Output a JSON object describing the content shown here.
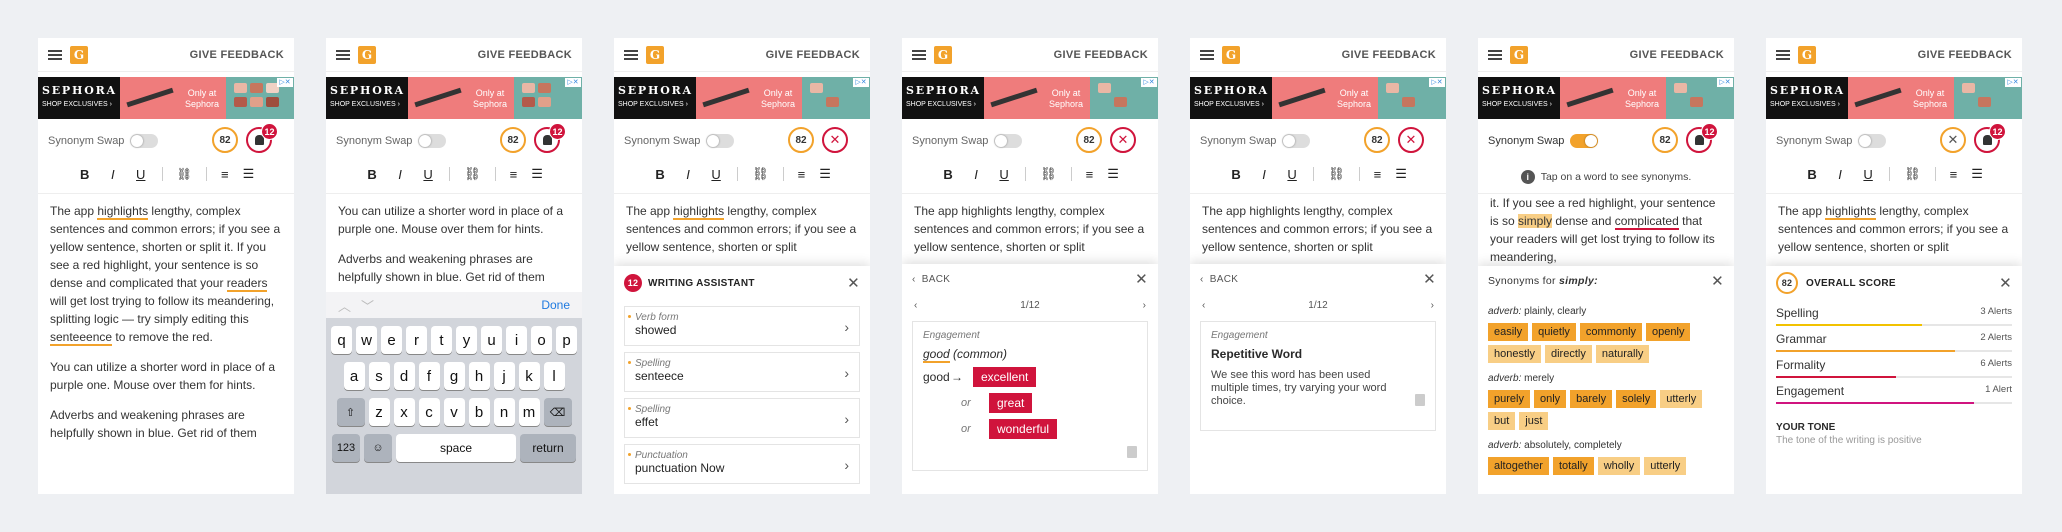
{
  "header": {
    "feedback_label": "GIVE FEEDBACK",
    "logo_letter": "G"
  },
  "ad": {
    "brand": "SEPHORA",
    "sub": "SHOP EXCLUSIVES ›",
    "only": "Only at Sephora",
    "adchoice": "▷✕"
  },
  "tools": {
    "synonym_swap": "Synonym Swap",
    "score": "82",
    "alerts": "12",
    "info": "Tap on a word to see synonyms."
  },
  "format": {
    "bold": "B",
    "italic": "I",
    "underline": "U",
    "link": "🔗",
    "ol": "☰",
    "ul": "☰"
  },
  "text": {
    "p1": [
      "The app ",
      "highlights",
      " lengthy, complex sentences and common errors; if you see a yellow sentence, shorten or split it. If you see a red highlight, your sentence is so dense and complicated that your ",
      "readers",
      " will get lost trying to follow its meandering, splitting logic — try simply editing this ",
      "senteeence",
      " to remove the red."
    ],
    "p2": "You can utilize a shorter word in place of a purple one. Mouse over them for hints.",
    "p3": "Adverbs and weakening phrases are helpfully shown in blue. Get rid of them",
    "p3_cut": "helpfully shown in blue. Get rid of them",
    "short": [
      "The app ",
      "highlights",
      " lengthy, complex sentences and common errors; if you see a yellow sentence, shorten or split"
    ],
    "syn_para": [
      "it. If you see a red highlight, your sentence is so ",
      "simply",
      " dense and ",
      "complicated",
      " that your readers will get lost trying to follow its meandering,"
    ]
  },
  "keyboard": {
    "done": "Done",
    "row1": [
      "q",
      "w",
      "e",
      "r",
      "t",
      "y",
      "u",
      "i",
      "o",
      "p"
    ],
    "row2": [
      "a",
      "s",
      "d",
      "f",
      "g",
      "h",
      "j",
      "k",
      "l"
    ],
    "row3": [
      "z",
      "x",
      "c",
      "v",
      "b",
      "n",
      "m"
    ],
    "num": "123",
    "emoji": "☺",
    "space": "space",
    "return": "return"
  },
  "assistant": {
    "title": "WRITING ASSISTANT",
    "alerts": [
      {
        "cat": "Verb form",
        "val": "showed"
      },
      {
        "cat": "Spelling",
        "val": "senteece"
      },
      {
        "cat": "Spelling",
        "val": "effet"
      },
      {
        "cat": "Punctuation",
        "val": "punctuation Now"
      }
    ]
  },
  "detail": {
    "back": "BACK",
    "pager": "1/12",
    "cat": "Engagement",
    "word": "good",
    "word_note": "(common)",
    "suggestions": [
      "excellent",
      "great",
      "wonderful"
    ],
    "or": "or",
    "card2_title": "Repetitive Word",
    "card2_desc": "We see this word has been used multiple times, try varying your word choice."
  },
  "synonyms": {
    "head": "Synonyms for ",
    "word": "simply:",
    "groups": [
      {
        "label": "adverb:",
        "meanings": "plainly, clearly",
        "words": [
          [
            "easily",
            "a"
          ],
          [
            "quietly",
            "a"
          ],
          [
            "commonly",
            "a"
          ],
          [
            "openly",
            "a"
          ],
          [
            "honestly",
            "b"
          ],
          [
            "directly",
            "b"
          ],
          [
            "naturally",
            "b"
          ]
        ]
      },
      {
        "label": "adverb:",
        "meanings": "merely",
        "words": [
          [
            "purely",
            "a"
          ],
          [
            "only",
            "a"
          ],
          [
            "barely",
            "a"
          ],
          [
            "solely",
            "a"
          ],
          [
            "utterly",
            "b"
          ],
          [
            "but",
            "b"
          ],
          [
            "just",
            "b"
          ]
        ]
      },
      {
        "label": "adverb:",
        "meanings": "absolutely, completely",
        "words": [
          [
            "altogether",
            "a"
          ],
          [
            "totally",
            "a"
          ],
          [
            "wholly",
            "b"
          ],
          [
            "utterly",
            "b"
          ]
        ]
      }
    ]
  },
  "overall": {
    "title": "OVERALL SCORE",
    "rows": [
      {
        "name": "Spelling",
        "alerts": "3 Alerts",
        "color": "#f2c200",
        "fill": 0.62
      },
      {
        "name": "Grammar",
        "alerts": "2 Alerts",
        "color": "#f2a22b",
        "fill": 0.76
      },
      {
        "name": "Formality",
        "alerts": "6 Alerts",
        "color": "#d0143c",
        "fill": 0.51
      },
      {
        "name": "Engagement",
        "alerts": "1 Alert",
        "color": "#d0147f",
        "fill": 0.84
      }
    ],
    "tone": "YOUR TONE",
    "tone_sub": "The tone of the writing is positive"
  }
}
